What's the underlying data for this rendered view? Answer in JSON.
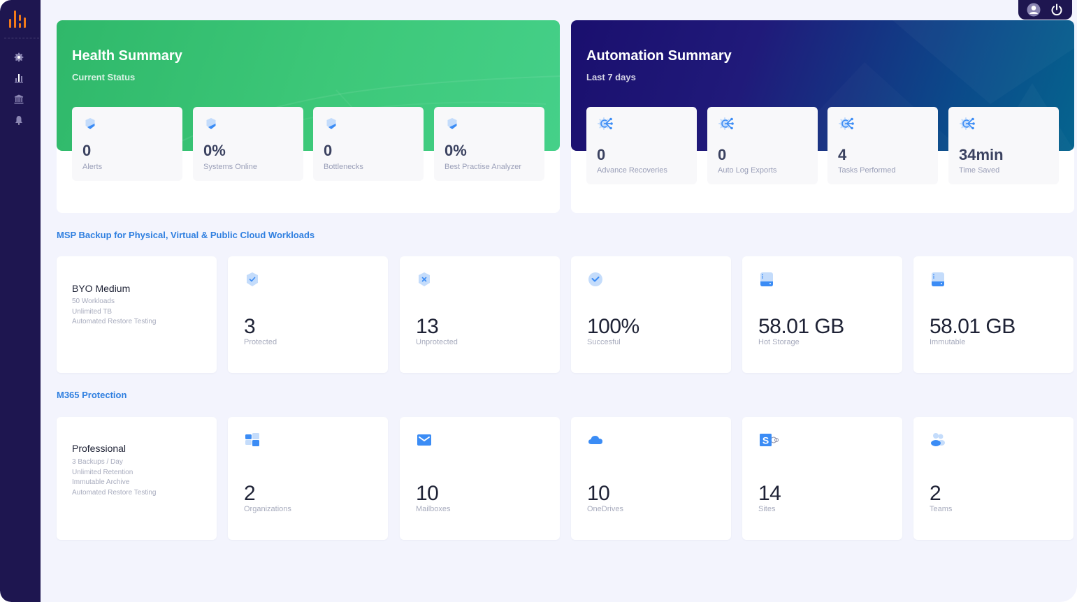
{
  "sidebar": {
    "logo": "bar-chart-logo",
    "items": [
      {
        "name": "settings",
        "icon": "gear-icon"
      },
      {
        "name": "reports",
        "icon": "bar-chart-icon"
      },
      {
        "name": "institution",
        "icon": "bank-icon"
      },
      {
        "name": "notifications",
        "icon": "bell-icon"
      }
    ]
  },
  "topbar": {
    "user_icon": "user-icon",
    "power_icon": "power-icon"
  },
  "health": {
    "title": "Health Summary",
    "subtitle": "Current Status",
    "stats": [
      {
        "value": "0",
        "label": "Alerts",
        "icon": "shield-icon"
      },
      {
        "value": "0%",
        "label": "Systems Online",
        "icon": "shield-icon"
      },
      {
        "value": "0",
        "label": "Bottlenecks",
        "icon": "shield-icon"
      },
      {
        "value": "0%",
        "label": "Best Practise Analyzer",
        "icon": "shield-icon"
      }
    ]
  },
  "automation": {
    "title": "Automation Summary",
    "subtitle": "Last 7 days",
    "stats": [
      {
        "value": "0",
        "label": "Advance Recoveries",
        "icon": "automation-gear-icon"
      },
      {
        "value": "0",
        "label": "Auto Log Exports",
        "icon": "automation-gear-icon"
      },
      {
        "value": "4",
        "label": "Tasks Performed",
        "icon": "automation-gear-icon"
      },
      {
        "value": "34min",
        "label": "Time Saved",
        "icon": "automation-gear-icon"
      }
    ]
  },
  "msp_backup": {
    "title": "MSP Backup for Physical, Virtual & Public Cloud Workloads",
    "plan": {
      "name": "BYO Medium",
      "features": [
        "50 Workloads",
        "Unlimited TB",
        "Automated Restore Testing"
      ]
    },
    "stats": [
      {
        "value": "3",
        "label": "Protected",
        "icon": "shield-check-icon"
      },
      {
        "value": "13",
        "label": "Unprotected",
        "icon": "shield-x-icon"
      },
      {
        "value": "100%",
        "label": "Succesful",
        "icon": "check-circle-icon"
      },
      {
        "value": "58.01 GB",
        "label": "Hot Storage",
        "icon": "storage-drive-icon"
      },
      {
        "value": "58.01 GB",
        "label": "Immutable",
        "icon": "storage-drive-icon"
      }
    ]
  },
  "m365": {
    "title": "M365 Protection",
    "plan": {
      "name": "Professional",
      "features": [
        "3 Backups / Day",
        "Unlimited Retention",
        "Immutable Archive",
        "Automated Restore Testing"
      ]
    },
    "stats": [
      {
        "value": "2",
        "label": "Organizations",
        "icon": "windows-icon"
      },
      {
        "value": "10",
        "label": "Mailboxes",
        "icon": "mail-icon"
      },
      {
        "value": "10",
        "label": "OneDrives",
        "icon": "cloud-icon"
      },
      {
        "value": "14",
        "label": "Sites",
        "icon": "sharepoint-icon"
      },
      {
        "value": "2",
        "label": "Teams",
        "icon": "teams-users-icon"
      }
    ]
  },
  "colors": {
    "sidebar": "#1e1650",
    "background": "#f3f4fd",
    "health_green": "#3dc879",
    "automation_navy": "#1a0f6e",
    "accent_blue": "#2f7fe0",
    "icon_blue": "#3b8cf5",
    "icon_light_blue": "#c4dcfb"
  }
}
